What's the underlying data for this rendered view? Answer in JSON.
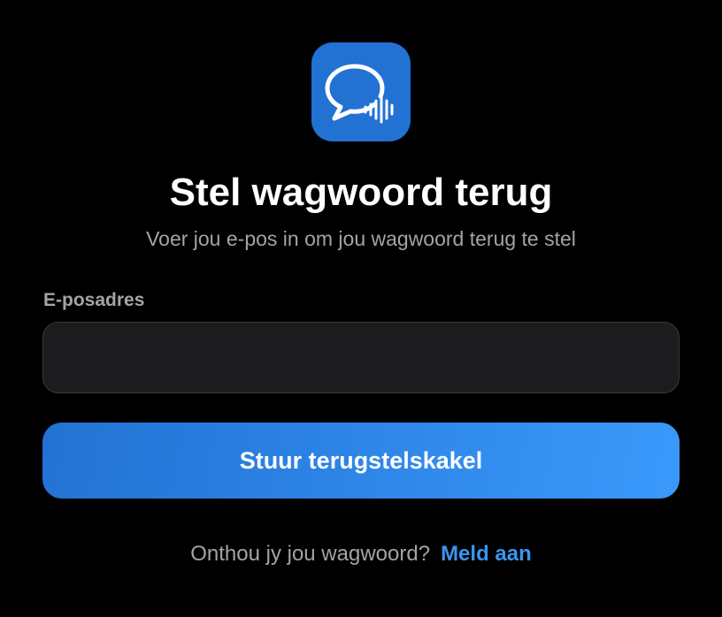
{
  "app_icon": {
    "icon_name": "chat-bubble-waveform-icon",
    "background_color": "#2272d3"
  },
  "header": {
    "title": "Stel wagwoord terug",
    "subtitle": "Voer jou e-pos in om jou wagwoord terug te stel"
  },
  "form": {
    "email_label": "E-posadres",
    "email_value": "",
    "email_placeholder": "",
    "submit_label": "Stuur terugstelskakel"
  },
  "footer": {
    "prompt": "Onthou jy jou wagwoord?",
    "signin_label": "Meld aan"
  },
  "colors": {
    "background": "#000000",
    "accent": "#3b95f0",
    "button_gradient_start": "#2272d3",
    "button_gradient_end": "#3a99fb"
  }
}
